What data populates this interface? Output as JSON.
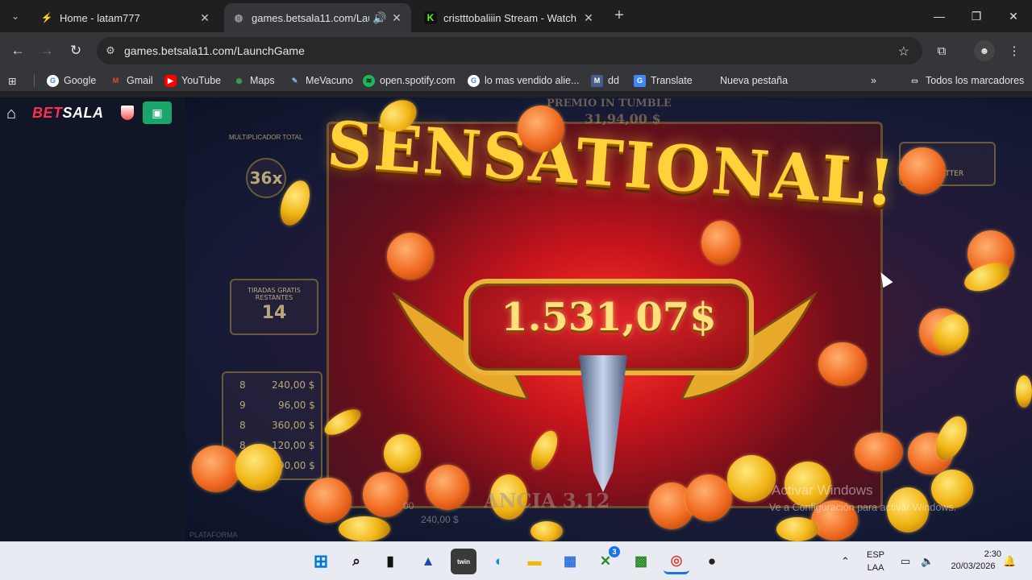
{
  "browser": {
    "tabs": [
      {
        "title": "Home - latam777",
        "favicon": "latam-icon",
        "active": false
      },
      {
        "title": "games.betsala11.com/Launc",
        "favicon": "globe-icon",
        "active": true,
        "audio": true
      },
      {
        "title": "cristttobaliiin Stream - Watch L",
        "favicon": "kick-icon",
        "active": false
      }
    ],
    "url": "games.betsala11.com/LaunchGame",
    "bookmarks": [
      {
        "label": "Google",
        "icon": "google-icon"
      },
      {
        "label": "Gmail",
        "icon": "gmail-icon"
      },
      {
        "label": "YouTube",
        "icon": "youtube-icon"
      },
      {
        "label": "Maps",
        "icon": "maps-icon"
      },
      {
        "label": "MeVacuno",
        "icon": "vaccine-icon"
      },
      {
        "label": "open.spotify.com",
        "icon": "spotify-icon"
      },
      {
        "label": "lo mas vendido alie...",
        "icon": "google-icon"
      },
      {
        "label": "dd",
        "icon": "dd-icon"
      },
      {
        "label": "Translate",
        "icon": "translate-icon"
      },
      {
        "label": "Nueva pestaña",
        "icon": ""
      }
    ],
    "all_bookmarks_label": "Todos los marcadores"
  },
  "site": {
    "logo_part1": "BET",
    "logo_part2": "SALA"
  },
  "game": {
    "banner": "SENSATIONAL!",
    "win_amount": "1.531,07$",
    "panel_multiplier_label": "MULTIPLICADOR TOTAL",
    "panel_multiplier_value": "36x",
    "panel_spins_label1": "TIRADAS GRATIS",
    "panel_spins_label2": "RESTANTES",
    "panel_spins_value": "14",
    "panel_prizes": [
      {
        "count": "8",
        "amount": "240,00 $"
      },
      {
        "count": "9",
        "amount": "96,00 $"
      },
      {
        "count": "8",
        "amount": "360,00 $"
      },
      {
        "count": "8",
        "amount": "120,00 $"
      },
      {
        "count": "9",
        "amount": "90,00 $"
      }
    ],
    "tumble_label": "PREMIO IN TUMBLE",
    "tumble_value": "31,94,00 $",
    "ganancia": "ANCIA 3.12",
    "scatter_label": "SCATTER",
    "bottom_amount1": "00",
    "bottom_amount2": "240,00 $",
    "footer_text": "PLATAFORMA",
    "watermark_line1": "Activar Windows",
    "watermark_line2": "Ve a Configuración para activar Windows."
  },
  "taskbar": {
    "apps": [
      {
        "name": "windows-start-icon",
        "label": ""
      },
      {
        "name": "search-icon",
        "label": ""
      },
      {
        "name": "file-explorer-icon",
        "label": ""
      },
      {
        "name": "affinity-icon",
        "label": ""
      },
      {
        "name": "twin-icon",
        "label": "twin"
      },
      {
        "name": "edge-icon",
        "label": ""
      },
      {
        "name": "folder-icon",
        "label": ""
      },
      {
        "name": "store-icon",
        "label": ""
      },
      {
        "name": "xbox-icon",
        "label": "",
        "badge": "3"
      },
      {
        "name": "minecraft-icon",
        "label": ""
      },
      {
        "name": "chrome-icon",
        "label": ""
      },
      {
        "name": "obs-icon",
        "label": ""
      }
    ],
    "lang1": "ESP",
    "lang2": "LAA",
    "time": "2:30",
    "date": "20/03/2026"
  }
}
